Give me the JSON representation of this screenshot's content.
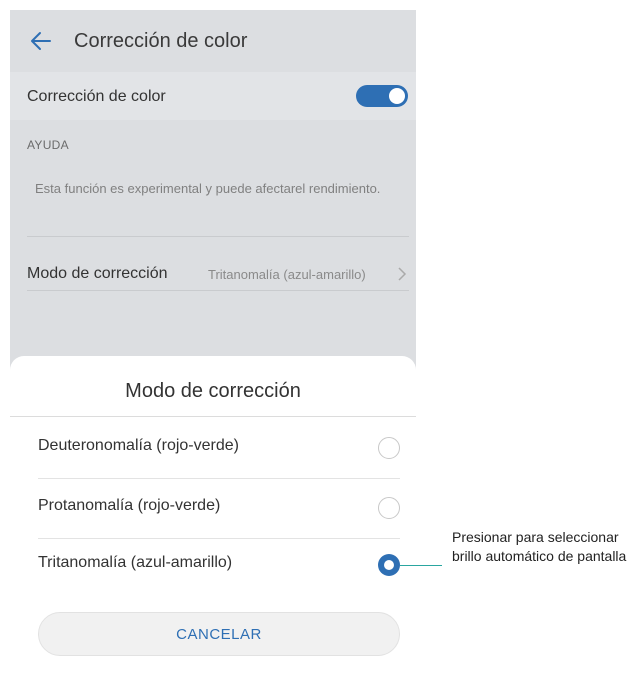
{
  "header": {
    "title": "Corrección de color"
  },
  "toggle_row": {
    "label": "Corrección de color",
    "enabled": true
  },
  "help": {
    "section_title": "AYUDA",
    "description": "Esta función es experimental y puede afectarel rendimiento."
  },
  "mode_row": {
    "label": "Modo de corrección",
    "value": "Tritanomalía (azul-amarillo)"
  },
  "dialog": {
    "title": "Modo de corrección",
    "options": [
      {
        "label": "Deuteronomalía (rojo-verde)",
        "selected": false
      },
      {
        "label": "Protanomalía (rojo-verde)",
        "selected": false
      },
      {
        "label": "Tritanomalía (azul-amarillo)",
        "selected": true
      }
    ],
    "cancel_label": "CANCELAR"
  },
  "annotation": {
    "text": "Presionar para seleccionar brillo automático de pantalla"
  },
  "colors": {
    "accent": "#2e6fb4",
    "callout_line": "#2aa6a0"
  }
}
